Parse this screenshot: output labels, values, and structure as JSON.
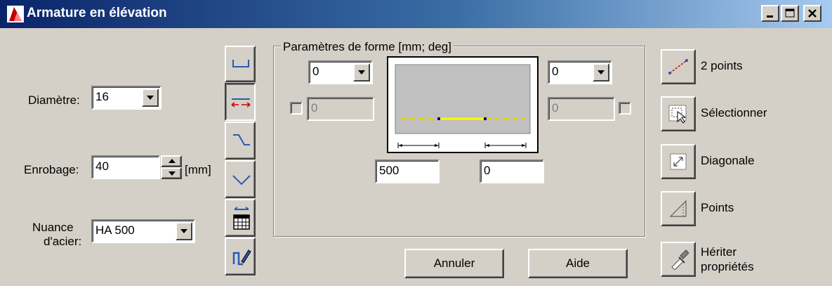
{
  "window": {
    "title": "Armature en élévation"
  },
  "left": {
    "diametre_label": "Diamètre:",
    "diametre_value": "16",
    "enrobage_label": "Enrobage:",
    "enrobage_value": "40",
    "enrobage_unit": "[mm]",
    "nuance_label_1": "Nuance",
    "nuance_label_2": "d'acier:",
    "nuance_value": "HA 500"
  },
  "shape_params": {
    "group_title": "Paramètres de forme [mm; deg]",
    "left_combo": "0",
    "right_combo": "0",
    "left_disabled_field": "0",
    "right_disabled_field": "0",
    "length_left": "500",
    "length_right": "0"
  },
  "buttons": {
    "cancel": "Annuler",
    "help": "Aide"
  },
  "tools": {
    "two_points": "2 points",
    "select": "Sélectionner",
    "diagonal": "Diagonale",
    "points": "Points",
    "inherit_1": "Hériter",
    "inherit_2": "propriétés"
  },
  "colors": {
    "titlebar_start": "#0a246a",
    "bar_line": "#ffff00",
    "accent_red": "#cc0000"
  },
  "icons": [
    "app-icon",
    "minimize-icon",
    "maximize-icon",
    "close-icon",
    "u-shape-icon",
    "straight-bar-icon",
    "crank-icon",
    "bent-down-icon",
    "calendar-icon",
    "edit-shape-icon",
    "two-points-icon",
    "select-icon",
    "diagonal-icon",
    "points-icon",
    "eyedropper-icon",
    "dropdown-arrow-icon"
  ]
}
